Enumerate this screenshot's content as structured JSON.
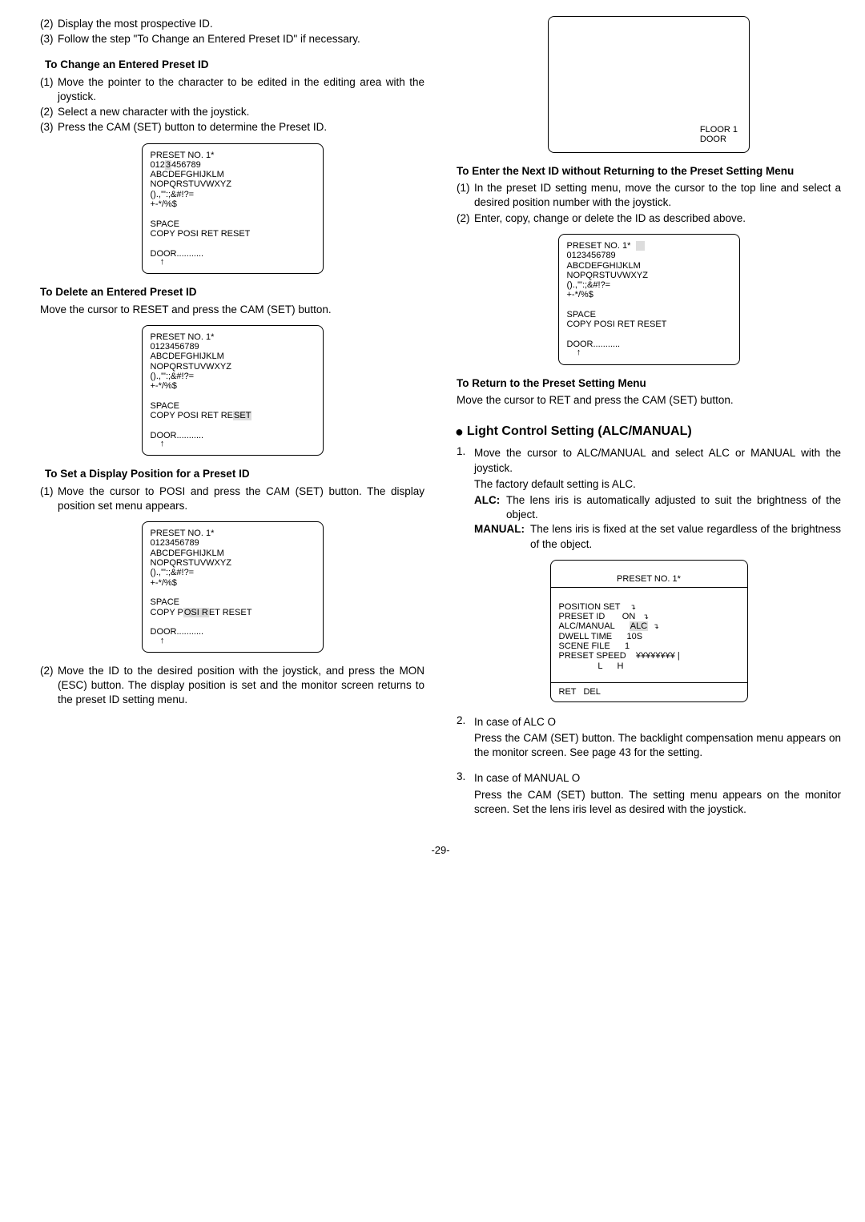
{
  "left": {
    "item2": "Display the most prospective ID.",
    "item3": "Follow the step \"To Change an Entered Preset ID\" if necessary.",
    "h_change": "To Change an Entered Preset ID",
    "change1": "Move the pointer to the character to be edited in the editing area with the joystick.",
    "change2": "Select a new character with the joystick.",
    "change3": "Press the CAM (SET) button to determine the Preset ID.",
    "osd_a": "PRESET NO. 1*\n0123456789\nABCDEFGHIJKLM\nNOPQRSTUVWXYZ\n().,'\":;&#!?=\n+-*/%$\n\nSPACE\nCOPY POSI RET RESET\n\nDOOR...........\n   ↑",
    "osd_a_hl": "3",
    "h_delete": "To Delete an Entered Preset ID",
    "delete_p": "Move the cursor to RESET and press the CAM (SET) button.",
    "osd_b": "PRESET NO. 1*\n0123456789\nABCDEFGHIJKLM\nNOPQRSTUVWXYZ\n().,'\":;&#!?=\n+-*/%$\n\nSPACE\nCOPY POSI RET RESET\n\nDOOR...........\n   ↑",
    "osd_b_hl": "SET",
    "h_set": "To Set a Display Position for a Preset ID",
    "set1": "Move the cursor to POSI and press the CAM (SET) button. The display position set menu appears.",
    "osd_c": "PRESET NO. 1*\n0123456789\nABCDEFGHIJKLM\nNOPQRSTUVWXYZ\n().,'\":;&#!?=\n+-*/%$\n\nSPACE\nCOPY POSI RET RESET\n\nDOOR...........\n   ↑",
    "osd_c_hl": "OSI R",
    "set2": "Move the ID to the desired position with the joystick, and press the MON (ESC) button. The display position is set and the monitor screen returns to the preset ID setting menu."
  },
  "right": {
    "osd_floor": "FLOOR 1\nDOOR",
    "h_enter": "To Enter the Next ID without Returning to the Preset Setting Menu",
    "enter1": "In the preset ID setting menu, move the cursor to the top line and select a desired position number with the joystick.",
    "enter2": "Enter, copy, change or delete the ID as described above.",
    "osd_d": "PRESET NO. 1*\n0123456789\nABCDEFGHIJKLM\nNOPQRSTUVWXYZ\n().,'\":;&#!?=\n+-*/%$\n\nSPACE\nCOPY POSI RET RESET\n\nDOOR...........\n   ↑",
    "h_return": "To Return to the Preset Setting Menu",
    "return_p": "Move the cursor to RET and press the CAM (SET) button.",
    "sec_head": "Light Control Setting (ALC/MANUAL)",
    "lc1a": "Move the cursor to ALC/MANUAL and select ALC or MANUAL with the joystick.",
    "lc1b": "The factory default setting is ALC.",
    "alc_lbl": "ALC:",
    "alc_txt": " The lens iris is automatically adjusted to suit the brightness of the object.",
    "man_lbl": "MANUAL:",
    "man_txt": " The lens iris is fixed at the set value regardless of the brightness of the object.",
    "osd_preset_head": "PRESET NO. 1*",
    "osd_rows": {
      "r1": "POSITION SET",
      "r2": "PRESET ID",
      "r2v": "ON",
      "r3": "ALC/MANUAL",
      "r3v": "ALC",
      "r4": "DWELL TIME",
      "r4v": "10S",
      "r5": "SCENE FILE",
      "r5v": "1",
      "r6": "PRESET SPEED",
      "r6v": "¥¥¥¥¥¥¥¥",
      "r7l": "L",
      "r7h": "H",
      "ret": "RET   DEL"
    },
    "lc2_head": "In case of ALC O",
    "lc2": "Press the CAM (SET) button. The backlight compensation menu appears on the monitor screen. See page 43 for the setting.",
    "lc3_head": "In case of MANUAL O",
    "lc3": "Press the CAM (SET) button. The setting menu appears on the monitor screen. Set the lens iris level as desired with the joystick."
  },
  "page": "-29-"
}
